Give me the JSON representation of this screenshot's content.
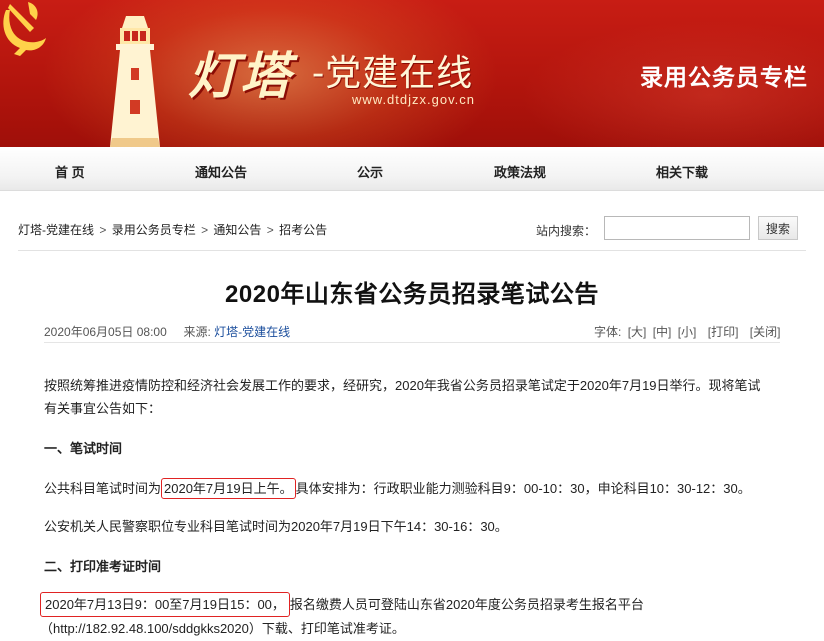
{
  "header": {
    "logo_title": "灯塔",
    "logo_subtitle": "-党建在线",
    "logo_url": "www.dtdjzx.gov.cn",
    "special_column": "录用公务员专栏"
  },
  "nav": {
    "items": [
      "首 页",
      "通知公告",
      "公示",
      "政策法规",
      "相关下载"
    ]
  },
  "breadcrumb": {
    "items": [
      "灯塔-党建在线",
      "录用公务员专栏",
      "通知公告",
      "招考公告"
    ],
    "separator": ">"
  },
  "search": {
    "label": "站内搜索：",
    "value": "",
    "button": "搜索"
  },
  "article": {
    "title": "2020年山东省公务员招录笔试公告",
    "date": "2020年06月05日 08:00",
    "source_label": "来源:",
    "source_value": "灯塔-党建在线",
    "tools_label": "字体:",
    "tools": [
      "[大]",
      "[中]",
      "[小]",
      "[打印]",
      "[关闭]"
    ],
    "intro_line1": "按照统筹推进疫情防控和经济社会发展工作的要求，经研究，2020年我省公务员招录笔试定于2020年7月19日举行。现将笔试",
    "intro_line2": "有关事宜公告如下：",
    "section1_heading": "一、笔试时间",
    "s1_p1_before": "公共科目笔试时间为",
    "s1_p1_highlight": "2020年7月19日上午。",
    "s1_p1_after": "具体安排为：行政职业能力测验科目9：00-10：30，申论科目10：30-12：30。",
    "s1_p2": "公安机关人民警察职位专业科目笔试时间为2020年7月19日下午14：30-16：30。",
    "section2_heading": "二、打印准考证时间",
    "s2_p1_highlight": "2020年7月13日9：00至7月19日15：00，",
    "s2_p1_after": "报名缴费人员可登陆山东省2020年度公务员招录考生报名平台",
    "s2_p1_line2": "（http://182.92.48.100/sddgkks2020）下载、打印笔试准考证。"
  },
  "colors": {
    "banner_red": "#b3150d",
    "highlight_border": "#e02323",
    "link_blue": "#1a4d9c"
  },
  "icons": [
    "party-emblem-icon",
    "lighthouse-icon"
  ]
}
